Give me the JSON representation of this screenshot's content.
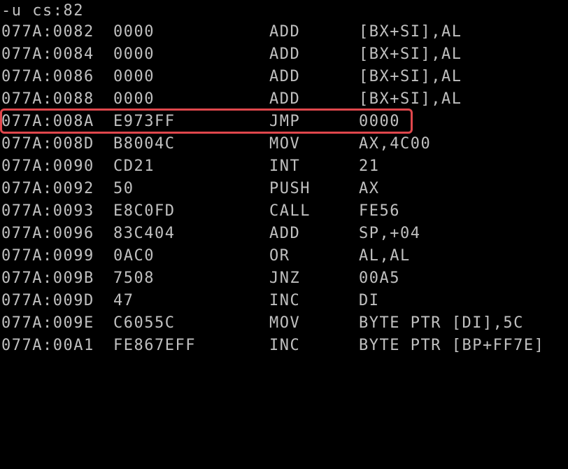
{
  "console": {
    "prompt": "-u cs:82",
    "rows": [
      {
        "addr": "077A:0082",
        "bytes": "0000",
        "mnemonic": "ADD",
        "operands": "[BX+SI],AL"
      },
      {
        "addr": "077A:0084",
        "bytes": "0000",
        "mnemonic": "ADD",
        "operands": "[BX+SI],AL"
      },
      {
        "addr": "077A:0086",
        "bytes": "0000",
        "mnemonic": "ADD",
        "operands": "[BX+SI],AL"
      },
      {
        "addr": "077A:0088",
        "bytes": "0000",
        "mnemonic": "ADD",
        "operands": "[BX+SI],AL"
      },
      {
        "addr": "077A:008A",
        "bytes": "E973FF",
        "mnemonic": "JMP",
        "operands": "0000"
      },
      {
        "addr": "077A:008D",
        "bytes": "B8004C",
        "mnemonic": "MOV",
        "operands": "AX,4C00"
      },
      {
        "addr": "077A:0090",
        "bytes": "CD21",
        "mnemonic": "INT",
        "operands": "21"
      },
      {
        "addr": "077A:0092",
        "bytes": "50",
        "mnemonic": "PUSH",
        "operands": "AX"
      },
      {
        "addr": "077A:0093",
        "bytes": "E8C0FD",
        "mnemonic": "CALL",
        "operands": "FE56"
      },
      {
        "addr": "077A:0096",
        "bytes": "83C404",
        "mnemonic": "ADD",
        "operands": "SP,+04"
      },
      {
        "addr": "077A:0099",
        "bytes": "0AC0",
        "mnemonic": "OR",
        "operands": "AL,AL"
      },
      {
        "addr": "077A:009B",
        "bytes": "7508",
        "mnemonic": "JNZ",
        "operands": "00A5"
      },
      {
        "addr": "077A:009D",
        "bytes": "47",
        "mnemonic": "INC",
        "operands": "DI"
      },
      {
        "addr": "077A:009E",
        "bytes": "C6055C",
        "mnemonic": "MOV",
        "operands": "BYTE PTR [DI],5C"
      },
      {
        "addr": "077A:00A1",
        "bytes": "FE867EFF",
        "mnemonic": "INC",
        "operands": "BYTE PTR [BP+FF7E]"
      }
    ]
  },
  "colors": {
    "background": "#000000",
    "text": "#c0c0c0",
    "highlight_border": "#e0474c"
  }
}
